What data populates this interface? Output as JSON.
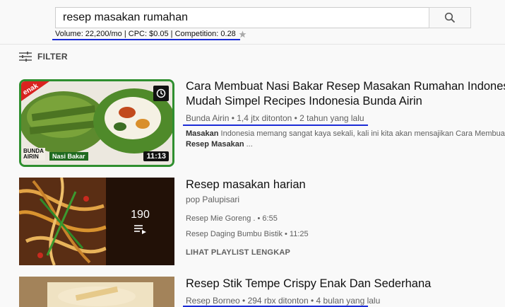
{
  "search": {
    "query": "resep masakan rumahan",
    "stats": "Volume: 22,200/mo | CPC: $0.05 | Competition: 0.28"
  },
  "filter": {
    "label": "FILTER"
  },
  "results": [
    {
      "type": "video",
      "title_line1": "Cara Membuat Nasi Bakar Resep Masakan Rumahan Indonesia",
      "title_line2": "Mudah Simpel Recipes Indonesia Bunda Airin",
      "meta": "Bunda Airin • 1,4 jtx ditonton • 2 tahun yang lalu",
      "desc_bold": "Masakan",
      "desc_line1_rest": " Indonesia memang sangat kaya sekali, kali ini kita akan mensajikan Cara Membuat",
      "desc_line2_bold": "Resep Masakan",
      "desc_line2_rest": " ...",
      "duration": "11:13",
      "thumb_tag": "enak",
      "thumb_brand": "BUNDA AIRIN",
      "thumb_caption": "Nasi Bakar"
    },
    {
      "type": "playlist",
      "title": "Resep masakan harian",
      "channel": "pop Palupisari",
      "count": "190",
      "items": [
        "Resep Mie Goreng . • 6:55",
        "Resep Daging Bumbu Bistik • 11:25"
      ],
      "lihat": "LIHAT PLAYLIST LENGKAP"
    },
    {
      "type": "video",
      "title": "Resep Stik Tempe Crispy Enak Dan Sederhana",
      "meta": "Resep Borneo • 294 rbx ditonton • 4 bulan yang lalu"
    }
  ],
  "colors": {
    "annotation_blue": "#1a2bd6",
    "thumb_border_green": "#2f8f2f"
  }
}
